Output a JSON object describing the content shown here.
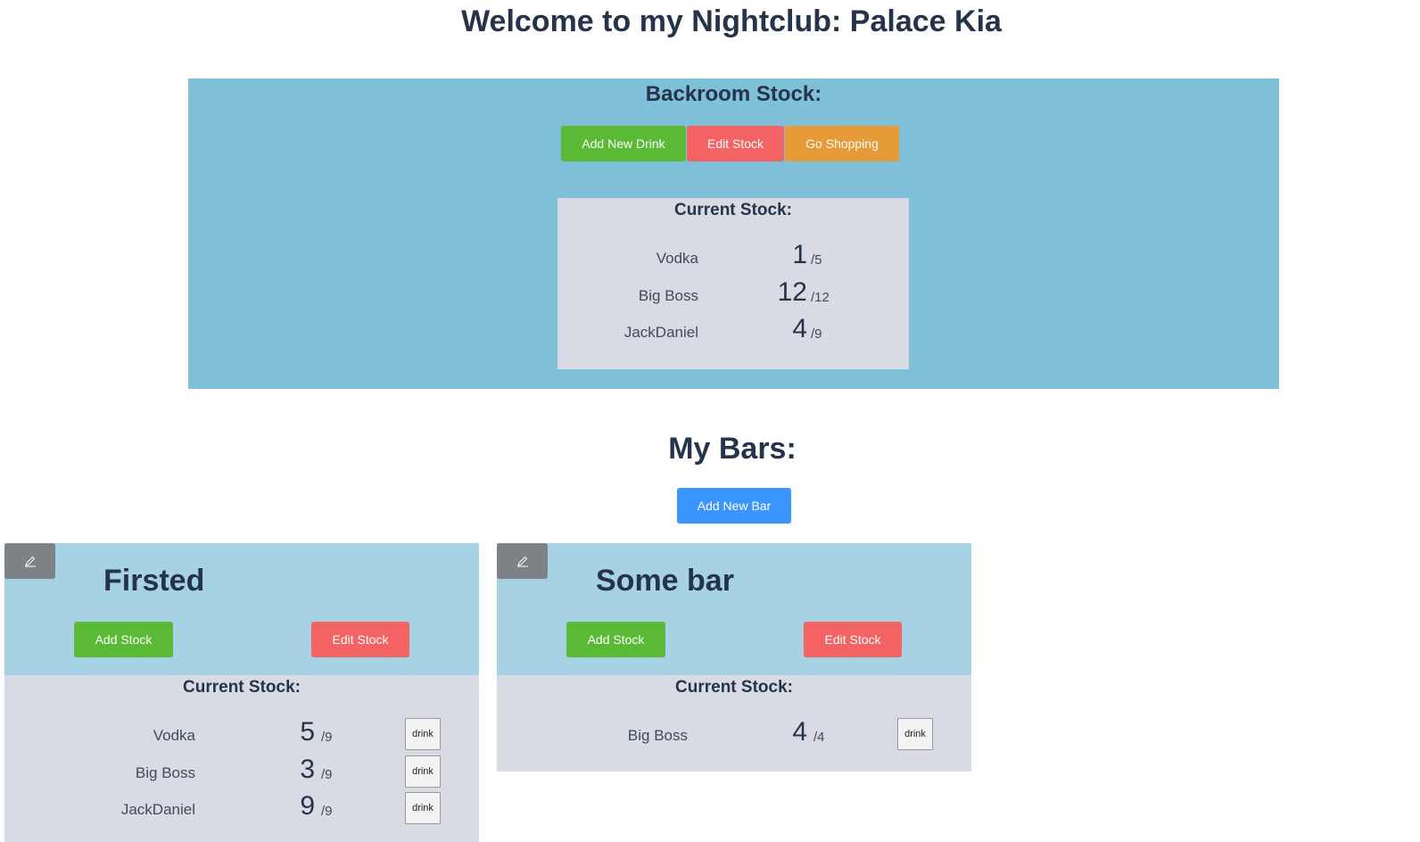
{
  "header": {
    "title": "Welcome to my Nightclub: Palace Kia"
  },
  "backroom": {
    "title": "Backroom Stock:",
    "buttons": {
      "add_drink": "Add New Drink",
      "edit_stock": "Edit Stock",
      "go_shopping": "Go Shopping"
    },
    "stock_title": "Current Stock:",
    "items": [
      {
        "name": "Vodka",
        "qty": "1",
        "max": "/5"
      },
      {
        "name": "Big Boss",
        "qty": "12",
        "max": "/12"
      },
      {
        "name": "JackDaniel",
        "qty": "4",
        "max": "/9"
      }
    ]
  },
  "bars_section": {
    "title": "My Bars:",
    "add_bar_label": "Add New Bar"
  },
  "bars": [
    {
      "name": "Firsted",
      "edit_icon": "pencil-icon",
      "add_stock_label": "Add Stock",
      "edit_stock_label": "Edit Stock",
      "stock_title": "Current Stock:",
      "items": [
        {
          "name": "Vodka",
          "qty": "5",
          "max": "/9",
          "action": "drink"
        },
        {
          "name": "Big Boss",
          "qty": "3",
          "max": "/9",
          "action": "drink"
        },
        {
          "name": "JackDaniel",
          "qty": "9",
          "max": "/9",
          "action": "drink"
        }
      ]
    },
    {
      "name": "Some bar",
      "edit_icon": "pencil-icon",
      "add_stock_label": "Add Stock",
      "edit_stock_label": "Edit Stock",
      "stock_title": "Current Stock:",
      "items": [
        {
          "name": "Big Boss",
          "qty": "4",
          "max": "/4",
          "action": "drink"
        }
      ]
    }
  ],
  "colors": {
    "backroom_bg": "#7fbfd8",
    "bar_head_bg": "#a6d2e3",
    "stock_bg": "#d8dbe3",
    "green": "#5aba35",
    "red": "#f36363",
    "orange": "#e79a38",
    "blue": "#3b95ff"
  }
}
